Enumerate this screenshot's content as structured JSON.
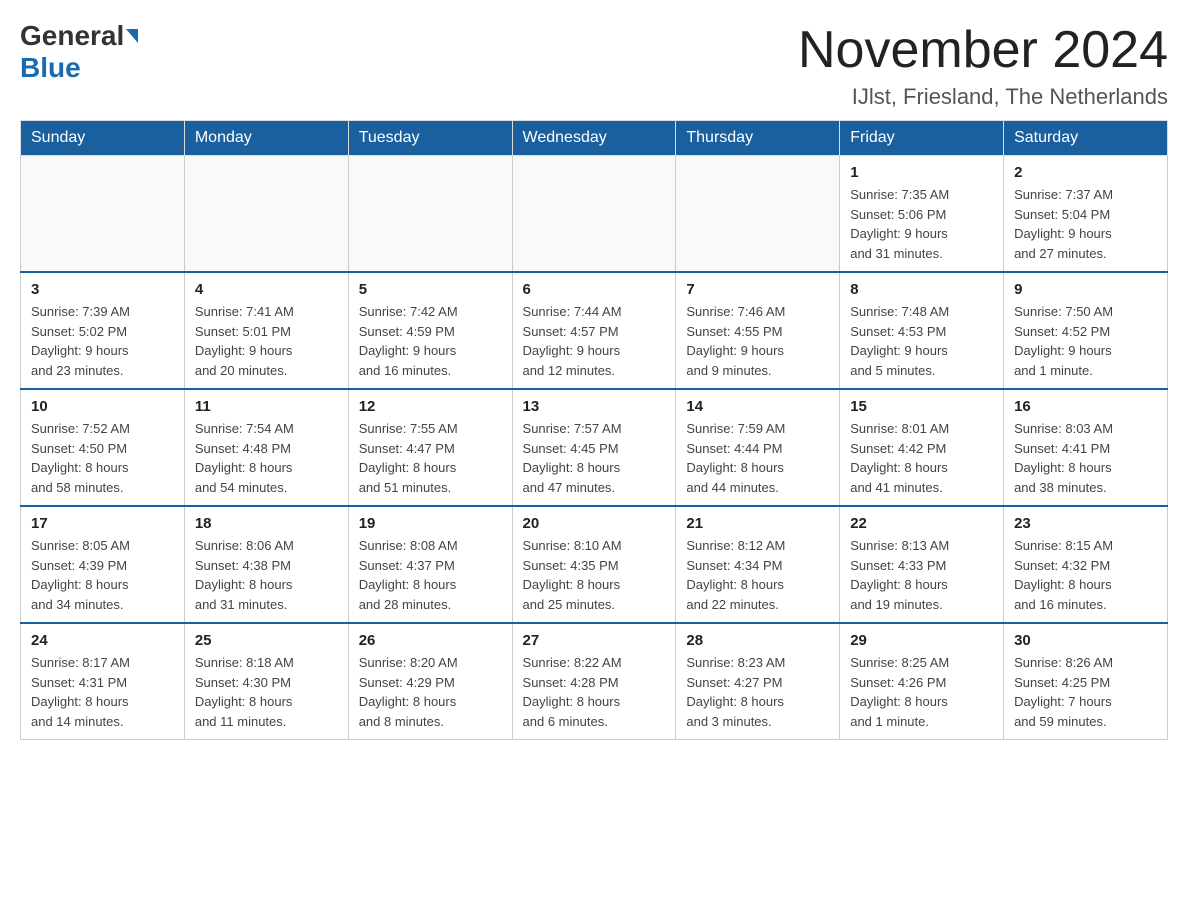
{
  "header": {
    "logo_general": "General",
    "logo_blue": "Blue",
    "month_title": "November 2024",
    "location": "IJlst, Friesland, The Netherlands"
  },
  "weekdays": [
    "Sunday",
    "Monday",
    "Tuesday",
    "Wednesday",
    "Thursday",
    "Friday",
    "Saturday"
  ],
  "weeks": [
    [
      {
        "day": "",
        "info": ""
      },
      {
        "day": "",
        "info": ""
      },
      {
        "day": "",
        "info": ""
      },
      {
        "day": "",
        "info": ""
      },
      {
        "day": "",
        "info": ""
      },
      {
        "day": "1",
        "info": "Sunrise: 7:35 AM\nSunset: 5:06 PM\nDaylight: 9 hours\nand 31 minutes."
      },
      {
        "day": "2",
        "info": "Sunrise: 7:37 AM\nSunset: 5:04 PM\nDaylight: 9 hours\nand 27 minutes."
      }
    ],
    [
      {
        "day": "3",
        "info": "Sunrise: 7:39 AM\nSunset: 5:02 PM\nDaylight: 9 hours\nand 23 minutes."
      },
      {
        "day": "4",
        "info": "Sunrise: 7:41 AM\nSunset: 5:01 PM\nDaylight: 9 hours\nand 20 minutes."
      },
      {
        "day": "5",
        "info": "Sunrise: 7:42 AM\nSunset: 4:59 PM\nDaylight: 9 hours\nand 16 minutes."
      },
      {
        "day": "6",
        "info": "Sunrise: 7:44 AM\nSunset: 4:57 PM\nDaylight: 9 hours\nand 12 minutes."
      },
      {
        "day": "7",
        "info": "Sunrise: 7:46 AM\nSunset: 4:55 PM\nDaylight: 9 hours\nand 9 minutes."
      },
      {
        "day": "8",
        "info": "Sunrise: 7:48 AM\nSunset: 4:53 PM\nDaylight: 9 hours\nand 5 minutes."
      },
      {
        "day": "9",
        "info": "Sunrise: 7:50 AM\nSunset: 4:52 PM\nDaylight: 9 hours\nand 1 minute."
      }
    ],
    [
      {
        "day": "10",
        "info": "Sunrise: 7:52 AM\nSunset: 4:50 PM\nDaylight: 8 hours\nand 58 minutes."
      },
      {
        "day": "11",
        "info": "Sunrise: 7:54 AM\nSunset: 4:48 PM\nDaylight: 8 hours\nand 54 minutes."
      },
      {
        "day": "12",
        "info": "Sunrise: 7:55 AM\nSunset: 4:47 PM\nDaylight: 8 hours\nand 51 minutes."
      },
      {
        "day": "13",
        "info": "Sunrise: 7:57 AM\nSunset: 4:45 PM\nDaylight: 8 hours\nand 47 minutes."
      },
      {
        "day": "14",
        "info": "Sunrise: 7:59 AM\nSunset: 4:44 PM\nDaylight: 8 hours\nand 44 minutes."
      },
      {
        "day": "15",
        "info": "Sunrise: 8:01 AM\nSunset: 4:42 PM\nDaylight: 8 hours\nand 41 minutes."
      },
      {
        "day": "16",
        "info": "Sunrise: 8:03 AM\nSunset: 4:41 PM\nDaylight: 8 hours\nand 38 minutes."
      }
    ],
    [
      {
        "day": "17",
        "info": "Sunrise: 8:05 AM\nSunset: 4:39 PM\nDaylight: 8 hours\nand 34 minutes."
      },
      {
        "day": "18",
        "info": "Sunrise: 8:06 AM\nSunset: 4:38 PM\nDaylight: 8 hours\nand 31 minutes."
      },
      {
        "day": "19",
        "info": "Sunrise: 8:08 AM\nSunset: 4:37 PM\nDaylight: 8 hours\nand 28 minutes."
      },
      {
        "day": "20",
        "info": "Sunrise: 8:10 AM\nSunset: 4:35 PM\nDaylight: 8 hours\nand 25 minutes."
      },
      {
        "day": "21",
        "info": "Sunrise: 8:12 AM\nSunset: 4:34 PM\nDaylight: 8 hours\nand 22 minutes."
      },
      {
        "day": "22",
        "info": "Sunrise: 8:13 AM\nSunset: 4:33 PM\nDaylight: 8 hours\nand 19 minutes."
      },
      {
        "day": "23",
        "info": "Sunrise: 8:15 AM\nSunset: 4:32 PM\nDaylight: 8 hours\nand 16 minutes."
      }
    ],
    [
      {
        "day": "24",
        "info": "Sunrise: 8:17 AM\nSunset: 4:31 PM\nDaylight: 8 hours\nand 14 minutes."
      },
      {
        "day": "25",
        "info": "Sunrise: 8:18 AM\nSunset: 4:30 PM\nDaylight: 8 hours\nand 11 minutes."
      },
      {
        "day": "26",
        "info": "Sunrise: 8:20 AM\nSunset: 4:29 PM\nDaylight: 8 hours\nand 8 minutes."
      },
      {
        "day": "27",
        "info": "Sunrise: 8:22 AM\nSunset: 4:28 PM\nDaylight: 8 hours\nand 6 minutes."
      },
      {
        "day": "28",
        "info": "Sunrise: 8:23 AM\nSunset: 4:27 PM\nDaylight: 8 hours\nand 3 minutes."
      },
      {
        "day": "29",
        "info": "Sunrise: 8:25 AM\nSunset: 4:26 PM\nDaylight: 8 hours\nand 1 minute."
      },
      {
        "day": "30",
        "info": "Sunrise: 8:26 AM\nSunset: 4:25 PM\nDaylight: 7 hours\nand 59 minutes."
      }
    ]
  ]
}
